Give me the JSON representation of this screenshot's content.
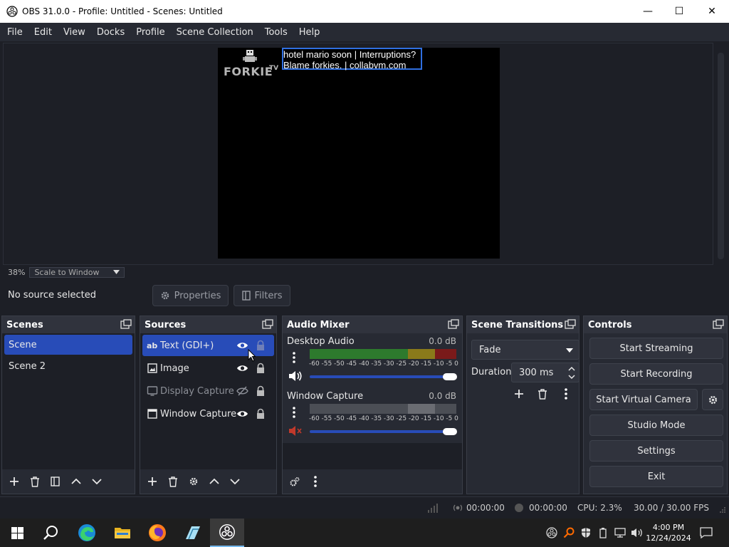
{
  "window": {
    "title": "OBS 31.0.0 - Profile: Untitled - Scenes: Untitled",
    "controls": {
      "minimize": "—",
      "maximize": "☐",
      "close": "✕"
    }
  },
  "menu": [
    "File",
    "Edit",
    "View",
    "Docks",
    "Profile",
    "Scene Collection",
    "Tools",
    "Help"
  ],
  "preview": {
    "overlay_text_line1": "hotel mario soon | Interruptions?",
    "overlay_text_line2": "Blame forkies. | collabvm.com",
    "logo_text": "FORKIE",
    "logo_superscript": "TV",
    "zoom_percent": "38%",
    "zoom_mode": "Scale to Window"
  },
  "context_bar": {
    "no_source": "No source selected",
    "properties_label": "Properties",
    "filters_label": "Filters"
  },
  "scenes": {
    "title": "Scenes",
    "items": [
      {
        "label": "Scene",
        "selected": true
      },
      {
        "label": "Scene 2",
        "selected": false
      }
    ]
  },
  "sources": {
    "title": "Sources",
    "items": [
      {
        "label": "Text (GDI+)",
        "icon": "text-icon",
        "icon_glyph": "ab",
        "selected": true,
        "visible": true
      },
      {
        "label": "Image",
        "icon": "image-icon",
        "selected": false,
        "visible": true
      },
      {
        "label": "Display Capture",
        "icon": "display-icon",
        "selected": false,
        "visible": false
      },
      {
        "label": "Window Capture",
        "icon": "window-icon",
        "selected": false,
        "visible": true
      }
    ]
  },
  "audio_mixer": {
    "title": "Audio Mixer",
    "channels": [
      {
        "name": "Desktop Audio",
        "db": "0.0 dB",
        "muted": false,
        "volume": 1.0
      },
      {
        "name": "Window Capture",
        "db": "0.0 dB",
        "muted": true,
        "volume": 1.0
      }
    ],
    "ticks": [
      "-60",
      "-55",
      "-50",
      "-45",
      "-40",
      "-35",
      "-30",
      "-25",
      "-20",
      "-15",
      "-10",
      "-5",
      "0"
    ]
  },
  "scene_transitions": {
    "title": "Scene Transitions",
    "selected": "Fade",
    "duration_label": "Duration",
    "duration_value": "300 ms"
  },
  "controls": {
    "title": "Controls",
    "start_streaming": "Start Streaming",
    "start_recording": "Start Recording",
    "start_virtual_camera": "Start Virtual Camera",
    "studio_mode": "Studio Mode",
    "settings": "Settings",
    "exit": "Exit"
  },
  "status": {
    "stream_time": "00:00:00",
    "record_time": "00:00:00",
    "cpu": "CPU: 2.3%",
    "fps": "30.00 / 30.00 FPS"
  },
  "taskbar": {
    "time": "4:00 PM",
    "date": "12/24/2024"
  },
  "colors": {
    "accent": "#284cb8",
    "panel": "#272a33",
    "background": "#1d1f26",
    "meter_green": "#2d7a2d",
    "meter_yellow": "#8a7a1a",
    "meter_red": "#7a1a1a"
  }
}
